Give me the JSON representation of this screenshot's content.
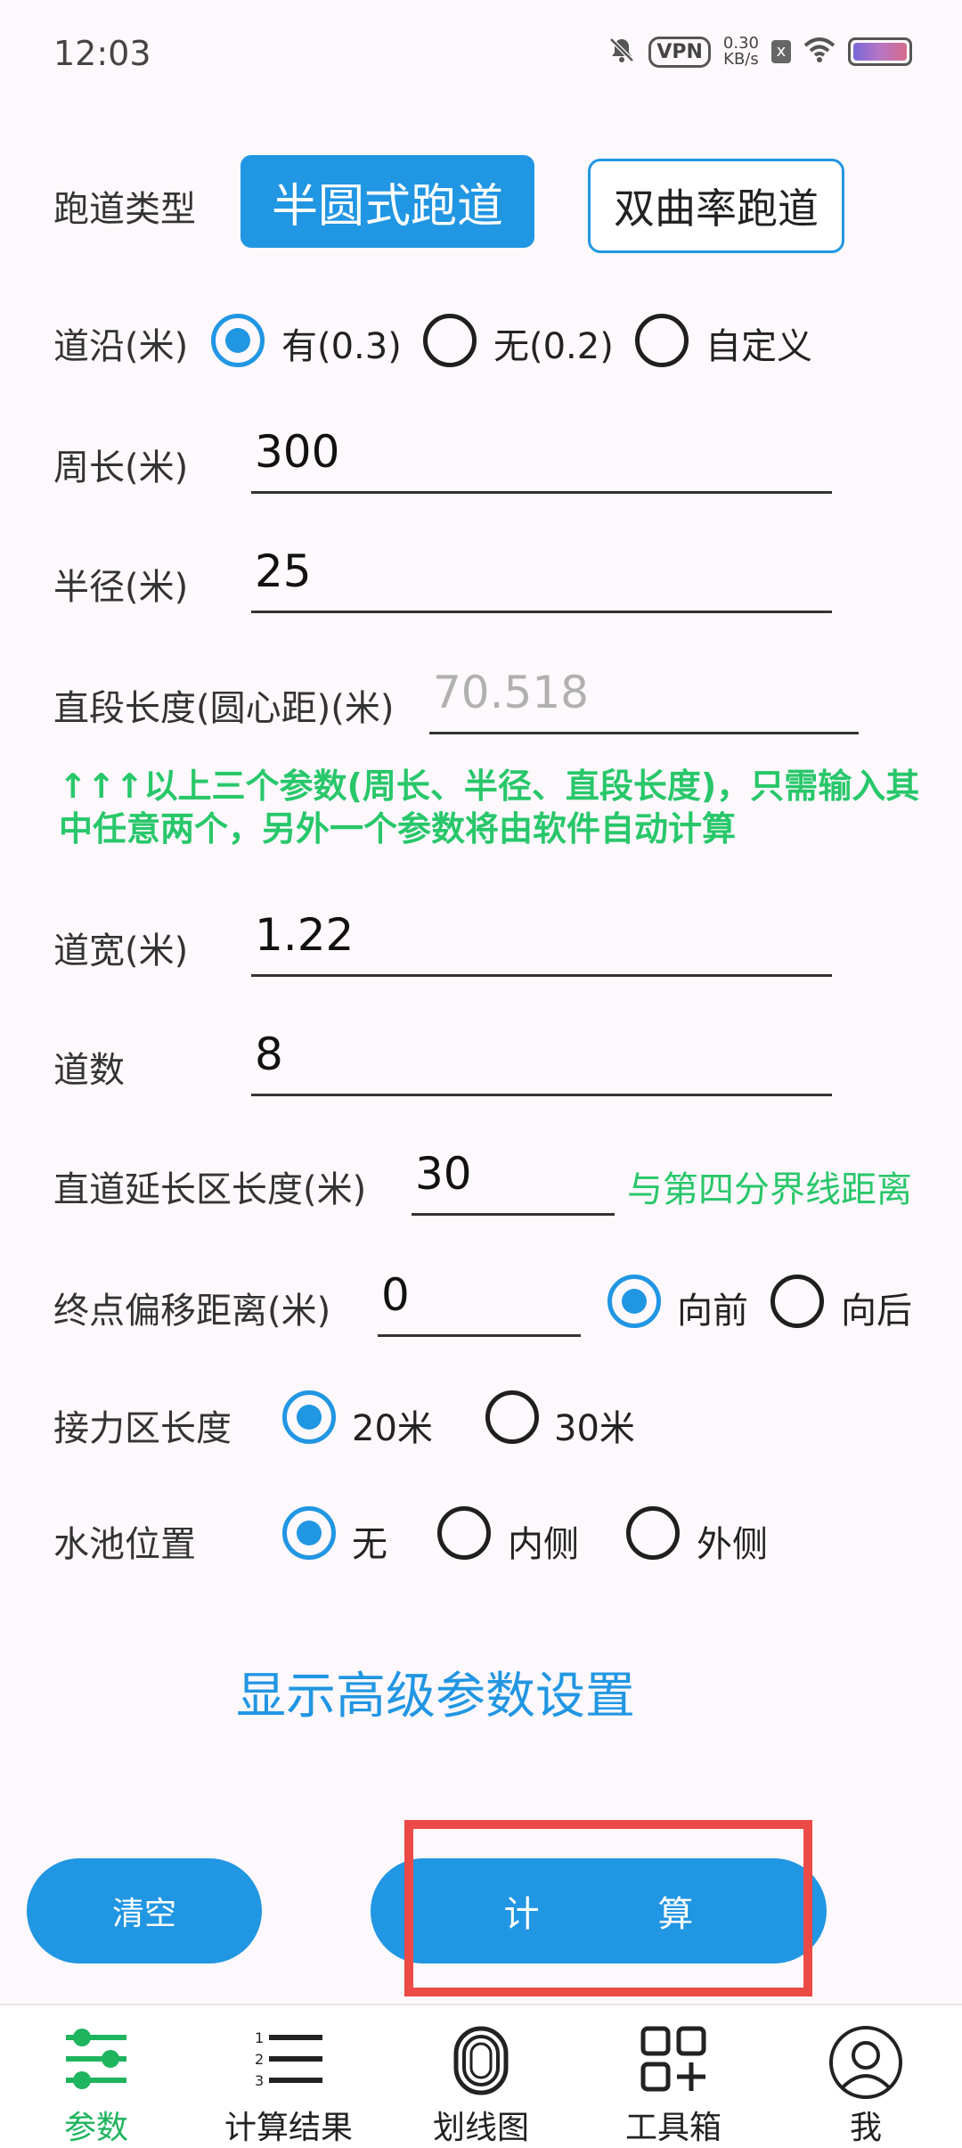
{
  "status": {
    "time": "12:03",
    "vpn": "VPN",
    "speed_value": "0.30",
    "speed_unit": "KB/s",
    "x_badge": "x"
  },
  "track_type": {
    "label": "跑道类型",
    "options": [
      "半圆式跑道",
      "双曲率跑道"
    ],
    "selected": "半圆式跑道"
  },
  "curb": {
    "label": "道沿(米)",
    "options": [
      "有(0.3)",
      "无(0.2)",
      "自定义"
    ],
    "selected": "有(0.3)"
  },
  "perimeter": {
    "label": "周长(米)",
    "value": "300"
  },
  "radius": {
    "label": "半径(米)",
    "value": "25"
  },
  "straight": {
    "label": "直段长度(圆心距)(米)",
    "value": "70.518"
  },
  "note": "↑↑↑以上三个参数(周长、半径、直段长度)，只需输入其中任意两个，另外一个参数将由软件自动计算",
  "lane_width": {
    "label": "道宽(米)",
    "value": "1.22"
  },
  "lanes": {
    "label": "道数",
    "value": "8"
  },
  "extension": {
    "label": "直道延长区长度(米)",
    "value": "30",
    "hint": "与第四分界线距离"
  },
  "finish_offset": {
    "label": "终点偏移距离(米)",
    "value": "0",
    "options": [
      "向前",
      "向后"
    ],
    "selected": "向前"
  },
  "relay": {
    "label": "接力区长度",
    "options": [
      "20米",
      "30米"
    ],
    "selected": "20米"
  },
  "pool": {
    "label": "水池位置",
    "options": [
      "无",
      "内侧",
      "外侧"
    ],
    "selected": "无"
  },
  "advanced_link": "显示高级参数设置",
  "buttons": {
    "clear": "清空",
    "calculate": "计 算"
  },
  "nav": {
    "items": [
      "参数",
      "计算结果",
      "划线图",
      "工具箱",
      "我"
    ],
    "active": "参数"
  },
  "colors": {
    "accent": "#2196e3",
    "green": "#28c76a",
    "highlight": "#ec4a46"
  }
}
